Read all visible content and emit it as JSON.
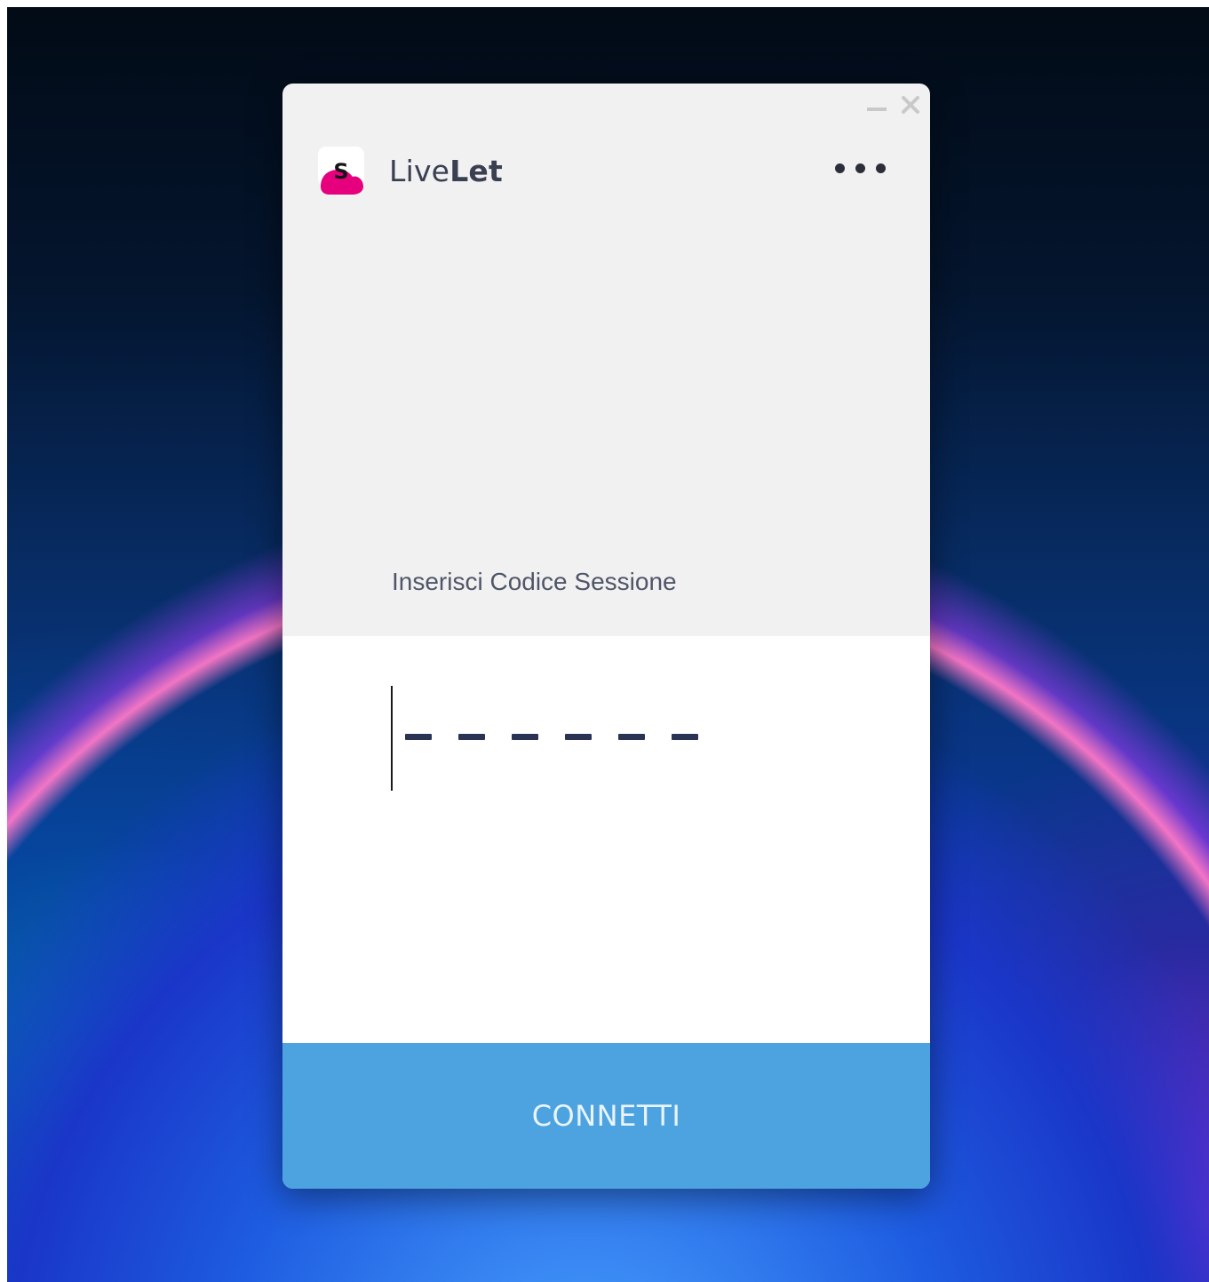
{
  "window": {
    "controls": {
      "minimize_icon": "minimize-icon",
      "close_icon": "close-icon"
    }
  },
  "header": {
    "logo_letter": "S",
    "app_name_regular": "Live",
    "app_name_bold": "Let",
    "more_icon": "more-horizontal-icon"
  },
  "session": {
    "label": "Inserisci Codice Sessione",
    "code_value": "",
    "code_length": 6
  },
  "actions": {
    "connect_label": "CONNETTI"
  },
  "colors": {
    "brand_pink": "#e6007e",
    "button_blue": "#4da3e0",
    "window_bg": "#f1f1f1",
    "dash_color": "#2b3354"
  }
}
